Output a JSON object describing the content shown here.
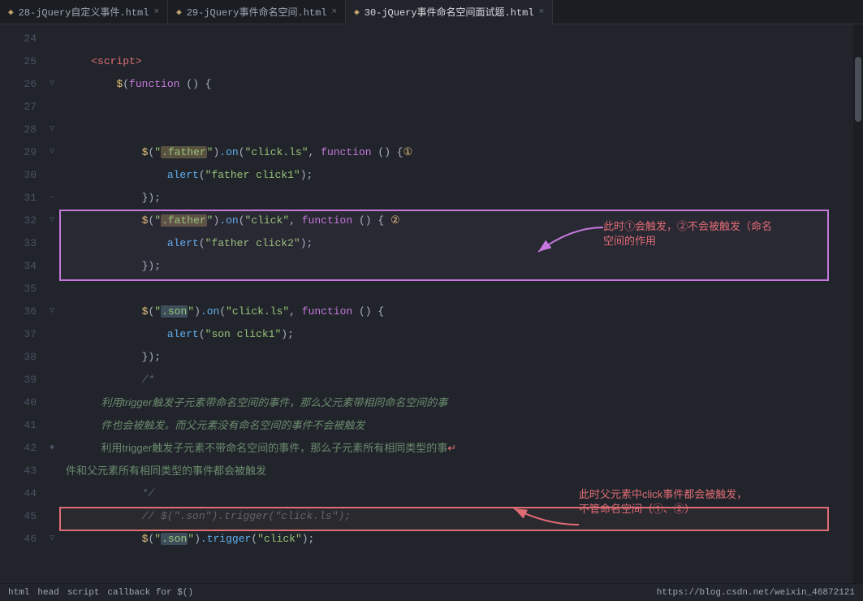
{
  "tabs": [
    {
      "label": "28-jQuery自定义事件.html",
      "active": false,
      "icon": "html"
    },
    {
      "label": "29-jQuery事件命名空间.html",
      "active": false,
      "icon": "html"
    },
    {
      "label": "30-jQuery事件命名空间面试题.html",
      "active": true,
      "icon": "html"
    }
  ],
  "lines": [
    {
      "num": "24",
      "fold": "",
      "code": ""
    },
    {
      "num": "25",
      "fold": "",
      "code": "    <script>"
    },
    {
      "num": "26",
      "fold": "▽",
      "code": "        $(function () {"
    },
    {
      "num": "27",
      "fold": "",
      "code": ""
    },
    {
      "num": "28",
      "fold": "",
      "code": ""
    },
    {
      "num": "29",
      "fold": "▽",
      "code": "            $(\".father\").on(\"click.ls\", function () {①"
    },
    {
      "num": "30",
      "fold": "",
      "code": "                alert(\"father click1\");"
    },
    {
      "num": "31",
      "fold": "",
      "code": "            });"
    },
    {
      "num": "32",
      "fold": "▽",
      "code": "            $(\".father\").on(\"click\", function () { ②"
    },
    {
      "num": "33",
      "fold": "",
      "code": "                alert(\"father click2\");"
    },
    {
      "num": "34",
      "fold": "",
      "code": "            });"
    },
    {
      "num": "35",
      "fold": "",
      "code": ""
    },
    {
      "num": "36",
      "fold": "▽",
      "code": "            $(\".son\").on(\"click.ls\", function () {"
    },
    {
      "num": "37",
      "fold": "",
      "code": "                alert(\"son click1\");"
    },
    {
      "num": "38",
      "fold": "",
      "code": "            });"
    },
    {
      "num": "39",
      "fold": "",
      "code": "            /*"
    },
    {
      "num": "40",
      "fold": "",
      "code": "            利用trigger触发子元素带命名空间的事件，那么父元素带相同命名空间的事"
    },
    {
      "num": "41",
      "fold": "",
      "code": "            件也会被触发。而父元素没有命名空间的事件不会被触发"
    },
    {
      "num": "42",
      "fold": "◆",
      "code": "            利用trigger触发子元素不带命名空间的事件，那么子元素所有相同类型的事"
    },
    {
      "num": "43",
      "fold": "",
      "code": "件和父元素所有相同类型的事件都会被触发"
    },
    {
      "num": "44",
      "fold": "",
      "code": "            */"
    },
    {
      "num": "45",
      "fold": "",
      "code": "            // $(\".son\").trigger(\"click.ls\");"
    },
    {
      "num": "46",
      "fold": "▽",
      "code": "            $(\".son\").trigger(\"click\");"
    }
  ],
  "status": {
    "left": [
      "html",
      "head",
      "script",
      "callback for $()"
    ],
    "right": "https://blog.csdn.net/weixin_46872121"
  },
  "annotations": {
    "top": "此时①会触发，②不会被触发（命名空间的作用",
    "bottom_label": "此时父元素中click事件都会被触发，不管命名空间（①、②）"
  }
}
